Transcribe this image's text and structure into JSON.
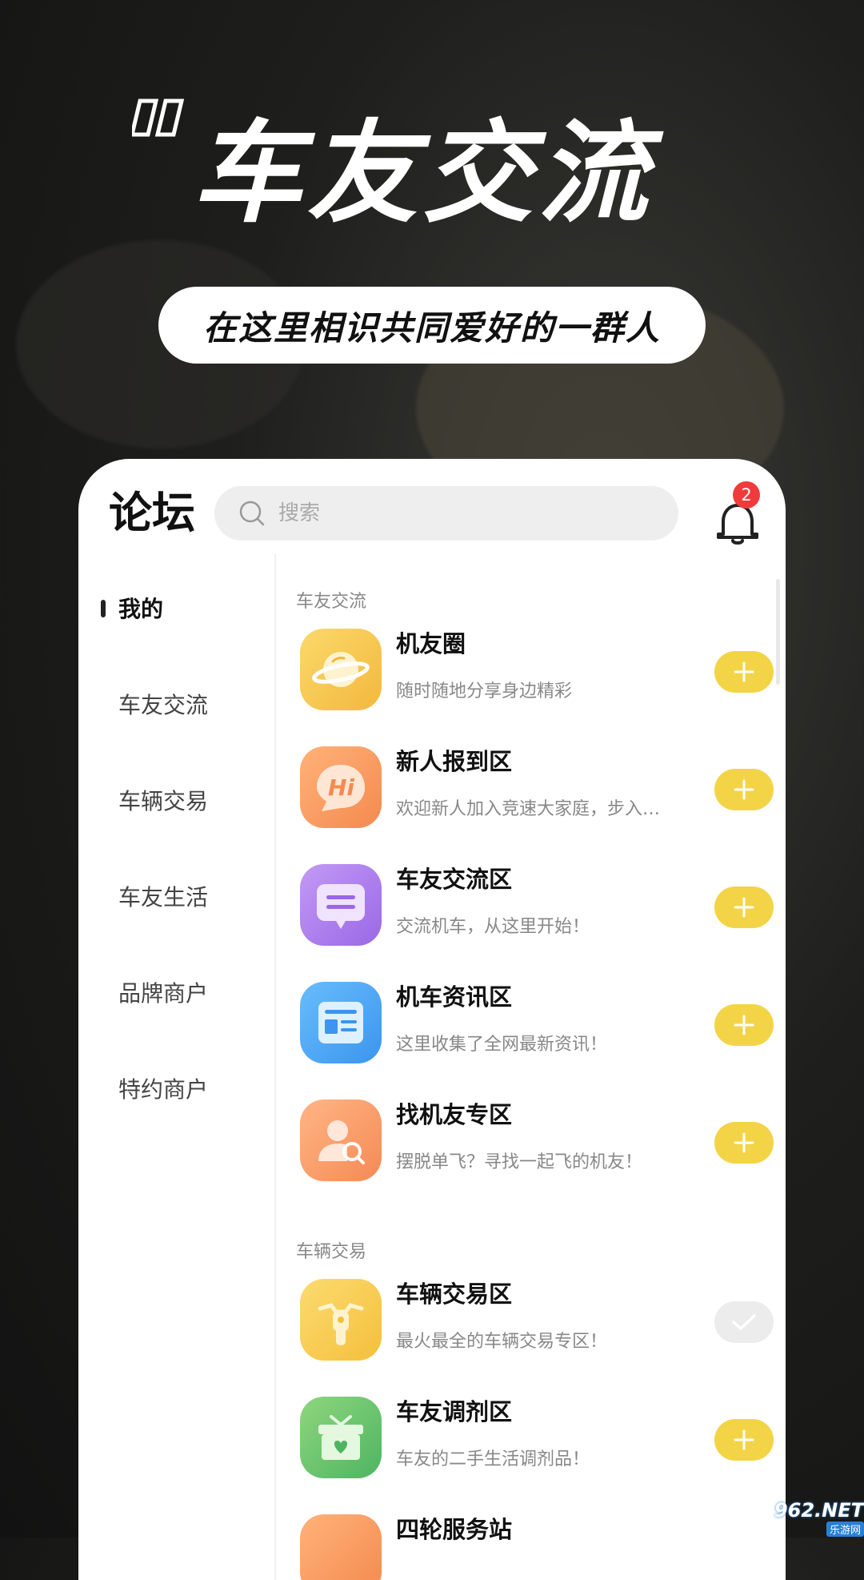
{
  "hero": {
    "title": "车友交流",
    "subtitle": "在这里相识共同爱好的一群人"
  },
  "header": {
    "title": "论坛",
    "search_placeholder": "搜索",
    "notification_count": "2"
  },
  "sidebar": {
    "items": [
      {
        "label": "我的",
        "active": true
      },
      {
        "label": "车友交流"
      },
      {
        "label": "车辆交易"
      },
      {
        "label": "车友生活"
      },
      {
        "label": "品牌商户"
      },
      {
        "label": "特约商户"
      }
    ]
  },
  "content": {
    "sections": [
      {
        "label": "车友交流",
        "items": [
          {
            "title": "机友圈",
            "desc": "随时随地分享身边精彩",
            "icon": "planet-icon",
            "status": "join"
          },
          {
            "title": "新人报到区",
            "desc": "欢迎新人加入竞速大家庭，步入…",
            "icon": "hi-bubble-icon",
            "status": "join"
          },
          {
            "title": "车友交流区",
            "desc": "交流机车，从这里开始！",
            "icon": "chat-icon",
            "status": "join"
          },
          {
            "title": "机车资讯区",
            "desc": "这里收集了全网最新资讯！",
            "icon": "news-icon",
            "status": "join"
          },
          {
            "title": "找机友专区",
            "desc": "摆脱单飞？寻找一起飞的机友！",
            "icon": "user-search-icon",
            "status": "join"
          }
        ]
      },
      {
        "label": "车辆交易",
        "items": [
          {
            "title": "车辆交易区",
            "desc": "最火最全的车辆交易专区！",
            "icon": "motorcycle-icon",
            "status": "joined"
          },
          {
            "title": "车友调剂区",
            "desc": "车友的二手生活调剂品！",
            "icon": "gift-box-icon",
            "status": "join"
          },
          {
            "title": "四轮服务站",
            "desc": "",
            "icon": "service-icon",
            "status": "join"
          }
        ]
      }
    ]
  },
  "watermark": {
    "main": "962.NET",
    "sub": "乐游网"
  },
  "colors": {
    "accent_yellow": "#f3d447",
    "badge_red": "#ef3b3b",
    "joined_gray": "#ececec"
  }
}
